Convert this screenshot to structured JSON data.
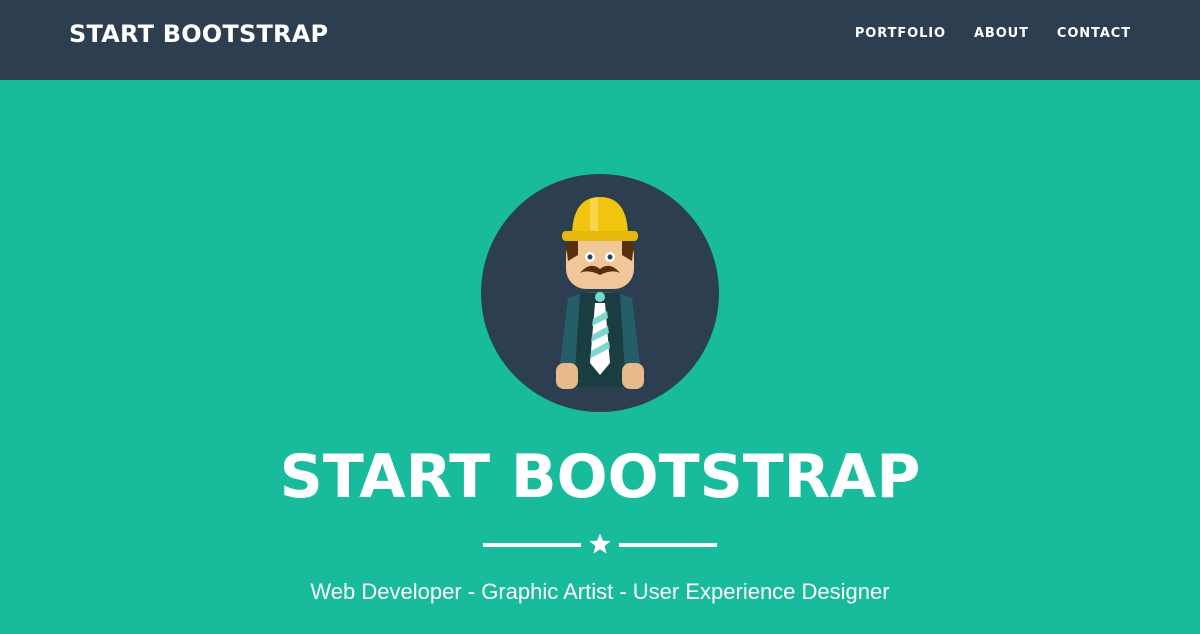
{
  "navbar": {
    "brand": "START BOOTSTRAP",
    "links": [
      "PORTFOLIO",
      "ABOUT",
      "CONTACT"
    ]
  },
  "hero": {
    "avatar_icon": "hardhat-developer-avatar-icon",
    "title": "START BOOTSTRAP",
    "divider_icon": "star-icon",
    "skills": "Web Developer - Graphic Artist - User Experience Designer"
  },
  "colors": {
    "navbar_bg": "#2c3e50",
    "hero_bg": "#18bc9c",
    "text": "#ffffff",
    "avatar_circle": "#2c3e50",
    "helmet": "#f1c40f"
  }
}
